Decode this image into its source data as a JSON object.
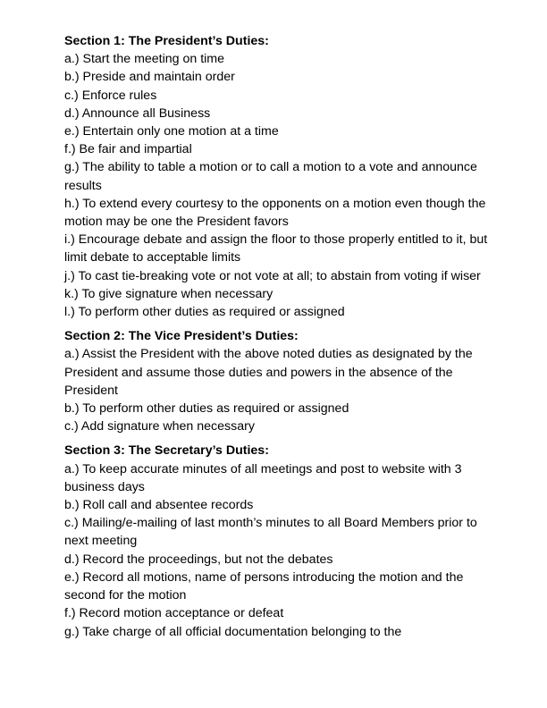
{
  "sections": [
    {
      "heading": "Section 1: The President’s Duties:",
      "items": [
        "a.) Start the meeting on time",
        "b.) Preside and maintain order",
        "c.) Enforce rules",
        "d.) Announce all Business",
        "e.) Entertain only one motion at a time",
        "f.) Be fair and impartial",
        "g.) The ability to table a motion or to call a motion to a vote and announce results",
        "h.) To extend every courtesy to the opponents on a motion even though the motion may be one the President favors",
        "i.) Encourage debate and assign the floor to those properly entitled to it, but limit debate to acceptable limits",
        "j.) To cast tie-breaking vote or not vote at all; to abstain from voting if wiser",
        "k.) To give signature when necessary",
        "l.) To perform other duties as required or assigned"
      ]
    },
    {
      "heading": "Section 2: The Vice President’s Duties:",
      "items": [
        "a.) Assist the President with the above noted duties as designated by the President and assume those duties and powers in the absence of the President",
        "b.) To perform other duties as required or assigned",
        "c.) Add signature when necessary"
      ]
    },
    {
      "heading": "Section 3: The Secretary’s Duties:",
      "items": [
        "a.) To keep accurate minutes of all meetings and post to website with 3 business days",
        "b.) Roll call and absentee records",
        "c.) Mailing/e-mailing of last month’s minutes to all Board Members prior to next meeting",
        "d.) Record the proceedings, but not the debates",
        "e.) Record all motions, name of persons introducing the motion and the second for the motion",
        "f.) Record motion acceptance or defeat",
        "g.) Take charge of all official documentation belonging to the"
      ]
    }
  ]
}
